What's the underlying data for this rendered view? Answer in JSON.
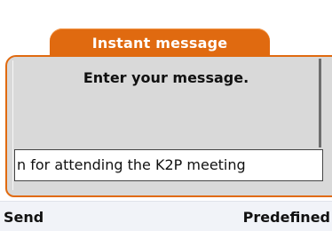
{
  "tab": {
    "title": "Instant message"
  },
  "prompt": {
    "text": "Enter your message."
  },
  "message": {
    "value": "n for attending the K2P meeting"
  },
  "softkeys": {
    "left": "Send",
    "right": "Predefined"
  },
  "colors": {
    "accent": "#e06a10",
    "panel": "#d9d9d9",
    "bar": "#f1f3f8"
  }
}
